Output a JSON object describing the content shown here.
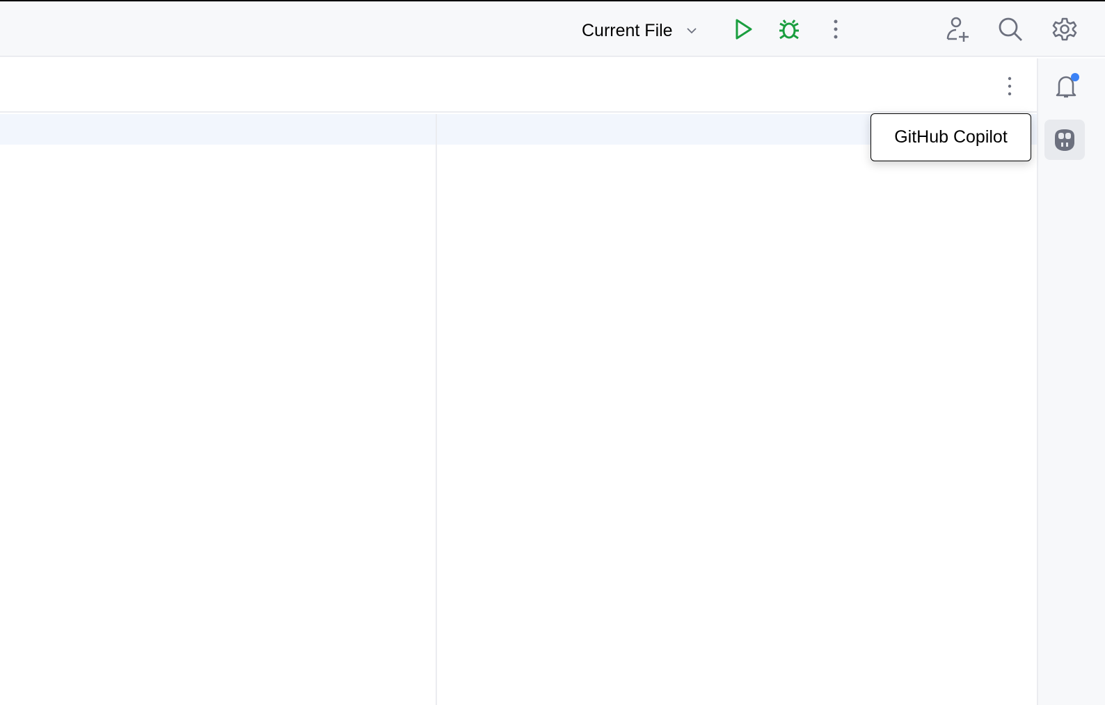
{
  "toolbar": {
    "run_config": "Current File",
    "icons": [
      "chevron-down-icon",
      "run-icon",
      "debug-icon",
      "more-icon",
      "add-user-icon",
      "search-icon",
      "gear-icon"
    ]
  },
  "panel": {
    "icons": [
      "more-icon"
    ]
  },
  "right_sidebar": {
    "icons": [
      "notifications-bell-icon",
      "copilot-icon"
    ]
  },
  "tooltip": {
    "text": "GitHub Copilot"
  },
  "colors": {
    "run_green": "#1a9e3f",
    "icon_gray": "#6c707e",
    "notification_dot": "#3b82f6"
  }
}
